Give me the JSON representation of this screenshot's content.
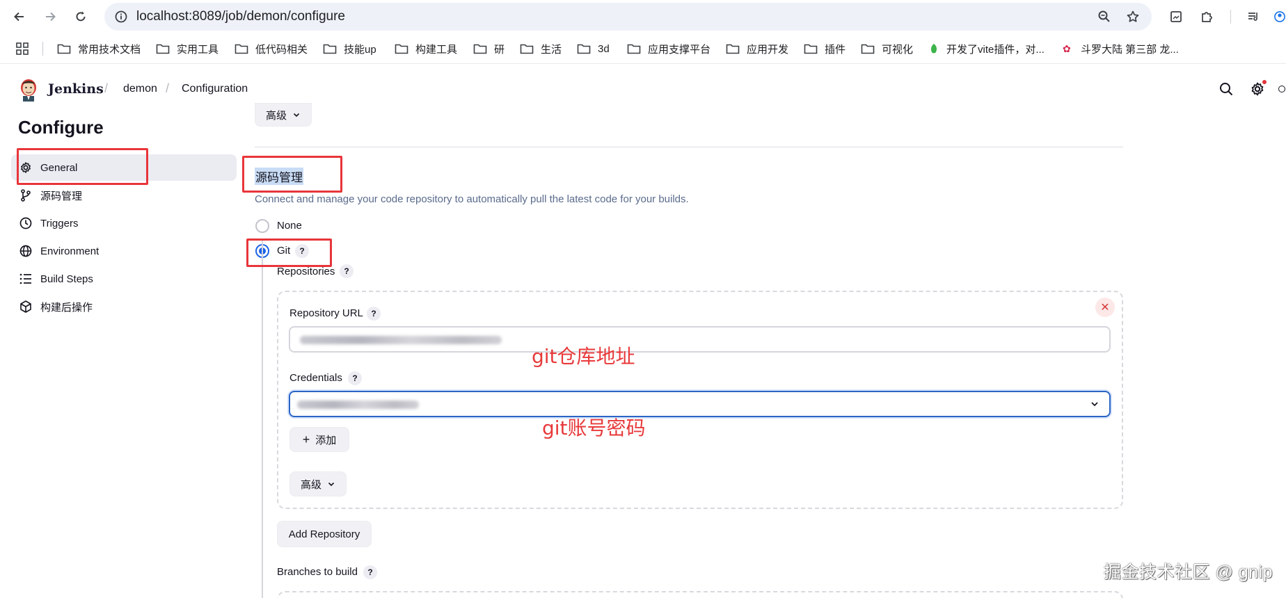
{
  "browser": {
    "url": "localhost:8089/job/demon/configure",
    "bookmarks": [
      "常用技术文档",
      "实用工具",
      "低代码相关",
      "技能up",
      "构建工具",
      "研",
      "生活",
      "3d",
      "应用支撑平台",
      "应用开发",
      "插件",
      "可视化",
      "开发了vite插件，对...",
      "斗罗大陆 第三部 龙..."
    ]
  },
  "header": {
    "brand": "Jenkins",
    "breadcrumbs": [
      "demon",
      "Configuration"
    ]
  },
  "sidebar": {
    "title": "Configure",
    "items": [
      {
        "label": "General",
        "icon": "gear-icon"
      },
      {
        "label": "源码管理",
        "icon": "git-branch-icon"
      },
      {
        "label": "Triggers",
        "icon": "clock-icon"
      },
      {
        "label": "Environment",
        "icon": "globe-icon"
      },
      {
        "label": "Build Steps",
        "icon": "list-icon"
      },
      {
        "label": "构建后操作",
        "icon": "cube-icon"
      }
    ]
  },
  "main": {
    "top_advanced_label": "高级",
    "scm": {
      "title": "源码管理",
      "description": "Connect and manage your code repository to automatically pull the latest code for your builds.",
      "options": [
        {
          "label": "None",
          "checked": false
        },
        {
          "label": "Git",
          "checked": true
        }
      ],
      "repositories_label": "Repositories",
      "repository_url_label": "Repository URL",
      "credentials_label": "Credentials",
      "add_label": "添加",
      "advanced_label": "高级",
      "add_repository_label": "Add Repository",
      "branches_label": "Branches to build",
      "help_glyph": "?"
    }
  },
  "annotations": {
    "repo_note": "git仓库地址",
    "cred_note": "git账号密码",
    "accent_color": "#e8393a"
  },
  "watermark": "掘金技术社区 @ gnip"
}
